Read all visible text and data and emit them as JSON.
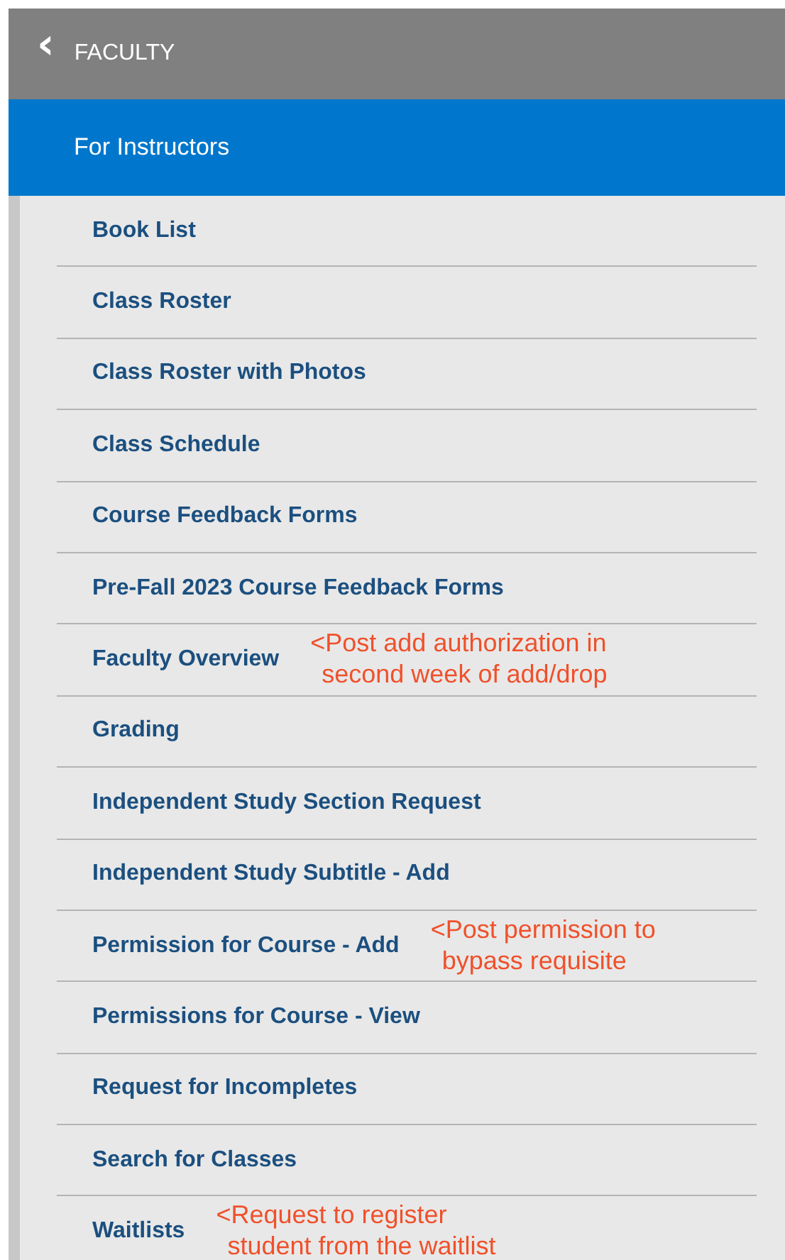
{
  "header": {
    "back_icon": "‹",
    "title": "FACULTY"
  },
  "section": {
    "title": "For Instructors"
  },
  "items": [
    {
      "label": "Book List"
    },
    {
      "label": "Class Roster"
    },
    {
      "label": "Class Roster with Photos"
    },
    {
      "label": "Class Schedule"
    },
    {
      "label": "Course Feedback Forms"
    },
    {
      "label": "Pre-Fall 2023 Course Feedback Forms"
    },
    {
      "label": "Faculty Overview",
      "note": [
        "<Post add authorization in",
        "second week of add/drop"
      ]
    },
    {
      "label": "Grading"
    },
    {
      "label": "Independent Study Section Request"
    },
    {
      "label": "Independent Study Subtitle - Add"
    },
    {
      "label": "Permission for Course - Add",
      "note": [
        "<Post permission to",
        "bypass requisite"
      ]
    },
    {
      "label": "Permissions for Course - View"
    },
    {
      "label": "Request for Incompletes"
    },
    {
      "label": "Search for Classes"
    },
    {
      "label": "Waitlists",
      "note": [
        "<Request to register",
        "student from the waitlist"
      ]
    }
  ]
}
